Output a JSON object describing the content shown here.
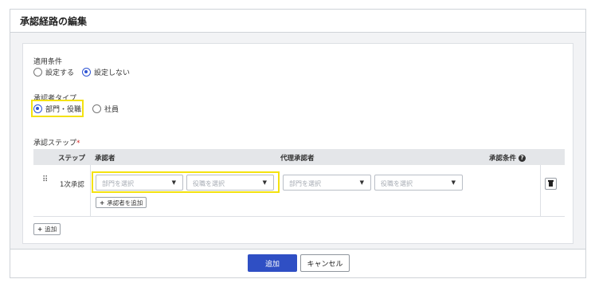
{
  "modal": {
    "title": "承認経路の編集"
  },
  "conditions": {
    "label": "適用条件",
    "options": [
      {
        "label": "設定する",
        "checked": false
      },
      {
        "label": "設定しない",
        "checked": true
      }
    ]
  },
  "approver_type": {
    "label": "承認者タイプ",
    "options": [
      {
        "label": "部門・役職",
        "checked": true
      },
      {
        "label": "社員",
        "checked": false
      }
    ]
  },
  "steps": {
    "label": "承認ステップ",
    "required_mark": "*",
    "columns": {
      "step": "ステップ",
      "approver": "承認者",
      "proxy": "代理承認者",
      "condition": "承認条件"
    },
    "rows": [
      {
        "name": "1次承認",
        "approver_department_placeholder": "部門を選択",
        "approver_position_placeholder": "役職を選択",
        "proxy_department_placeholder": "部門を選択",
        "proxy_position_placeholder": "役職を選択",
        "add_approver_label": "承認者を追加"
      }
    ],
    "add_step_label": "追加"
  },
  "footer": {
    "submit_label": "追加",
    "cancel_label": "キャンセル"
  },
  "colors": {
    "accent": "#2f4fc4",
    "highlight": "#f4e20f",
    "required": "#d62b2b"
  }
}
